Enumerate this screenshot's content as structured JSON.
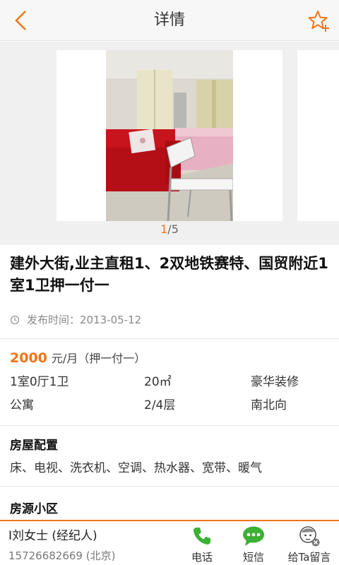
{
  "header": {
    "title": "详情",
    "back_icon": "back-arrow-icon",
    "fav_icon": "star-add-icon",
    "accent": "#f07417"
  },
  "gallery": {
    "current": "1",
    "total": "/5"
  },
  "listing": {
    "title": "建外大街,业主直租1、2双地铁赛特、国贸附近1室1卫押一付一",
    "publish": "发布时间：2013-05-12"
  },
  "price": {
    "amount": "2000",
    "unit": "元/月（押一付一）"
  },
  "specs": [
    [
      "1室0厅1卫",
      "20㎡",
      "豪华装修"
    ],
    [
      "公寓",
      "2/4层",
      "南北向"
    ]
  ],
  "config": {
    "heading": "房屋配置",
    "items": "床、电视、洗衣机、空调、热水器、宽带、暖气"
  },
  "community": {
    "heading": "房源小区"
  },
  "bottom": {
    "agent": "I刘女士 (经纪人)",
    "phone": "15726682669 (北京)",
    "call": "电话",
    "sms": "短信",
    "message": "给Ta留言"
  }
}
